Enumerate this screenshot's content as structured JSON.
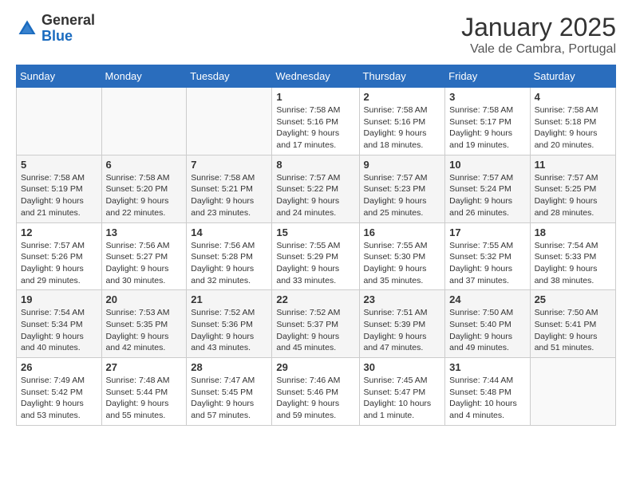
{
  "header": {
    "logo_general": "General",
    "logo_blue": "Blue",
    "month": "January 2025",
    "location": "Vale de Cambra, Portugal"
  },
  "days_of_week": [
    "Sunday",
    "Monday",
    "Tuesday",
    "Wednesday",
    "Thursday",
    "Friday",
    "Saturday"
  ],
  "weeks": [
    [
      {
        "day": "",
        "info": ""
      },
      {
        "day": "",
        "info": ""
      },
      {
        "day": "",
        "info": ""
      },
      {
        "day": "1",
        "info": "Sunrise: 7:58 AM\nSunset: 5:16 PM\nDaylight: 9 hours\nand 17 minutes."
      },
      {
        "day": "2",
        "info": "Sunrise: 7:58 AM\nSunset: 5:16 PM\nDaylight: 9 hours\nand 18 minutes."
      },
      {
        "day": "3",
        "info": "Sunrise: 7:58 AM\nSunset: 5:17 PM\nDaylight: 9 hours\nand 19 minutes."
      },
      {
        "day": "4",
        "info": "Sunrise: 7:58 AM\nSunset: 5:18 PM\nDaylight: 9 hours\nand 20 minutes."
      }
    ],
    [
      {
        "day": "5",
        "info": "Sunrise: 7:58 AM\nSunset: 5:19 PM\nDaylight: 9 hours\nand 21 minutes."
      },
      {
        "day": "6",
        "info": "Sunrise: 7:58 AM\nSunset: 5:20 PM\nDaylight: 9 hours\nand 22 minutes."
      },
      {
        "day": "7",
        "info": "Sunrise: 7:58 AM\nSunset: 5:21 PM\nDaylight: 9 hours\nand 23 minutes."
      },
      {
        "day": "8",
        "info": "Sunrise: 7:57 AM\nSunset: 5:22 PM\nDaylight: 9 hours\nand 24 minutes."
      },
      {
        "day": "9",
        "info": "Sunrise: 7:57 AM\nSunset: 5:23 PM\nDaylight: 9 hours\nand 25 minutes."
      },
      {
        "day": "10",
        "info": "Sunrise: 7:57 AM\nSunset: 5:24 PM\nDaylight: 9 hours\nand 26 minutes."
      },
      {
        "day": "11",
        "info": "Sunrise: 7:57 AM\nSunset: 5:25 PM\nDaylight: 9 hours\nand 28 minutes."
      }
    ],
    [
      {
        "day": "12",
        "info": "Sunrise: 7:57 AM\nSunset: 5:26 PM\nDaylight: 9 hours\nand 29 minutes."
      },
      {
        "day": "13",
        "info": "Sunrise: 7:56 AM\nSunset: 5:27 PM\nDaylight: 9 hours\nand 30 minutes."
      },
      {
        "day": "14",
        "info": "Sunrise: 7:56 AM\nSunset: 5:28 PM\nDaylight: 9 hours\nand 32 minutes."
      },
      {
        "day": "15",
        "info": "Sunrise: 7:55 AM\nSunset: 5:29 PM\nDaylight: 9 hours\nand 33 minutes."
      },
      {
        "day": "16",
        "info": "Sunrise: 7:55 AM\nSunset: 5:30 PM\nDaylight: 9 hours\nand 35 minutes."
      },
      {
        "day": "17",
        "info": "Sunrise: 7:55 AM\nSunset: 5:32 PM\nDaylight: 9 hours\nand 37 minutes."
      },
      {
        "day": "18",
        "info": "Sunrise: 7:54 AM\nSunset: 5:33 PM\nDaylight: 9 hours\nand 38 minutes."
      }
    ],
    [
      {
        "day": "19",
        "info": "Sunrise: 7:54 AM\nSunset: 5:34 PM\nDaylight: 9 hours\nand 40 minutes."
      },
      {
        "day": "20",
        "info": "Sunrise: 7:53 AM\nSunset: 5:35 PM\nDaylight: 9 hours\nand 42 minutes."
      },
      {
        "day": "21",
        "info": "Sunrise: 7:52 AM\nSunset: 5:36 PM\nDaylight: 9 hours\nand 43 minutes."
      },
      {
        "day": "22",
        "info": "Sunrise: 7:52 AM\nSunset: 5:37 PM\nDaylight: 9 hours\nand 45 minutes."
      },
      {
        "day": "23",
        "info": "Sunrise: 7:51 AM\nSunset: 5:39 PM\nDaylight: 9 hours\nand 47 minutes."
      },
      {
        "day": "24",
        "info": "Sunrise: 7:50 AM\nSunset: 5:40 PM\nDaylight: 9 hours\nand 49 minutes."
      },
      {
        "day": "25",
        "info": "Sunrise: 7:50 AM\nSunset: 5:41 PM\nDaylight: 9 hours\nand 51 minutes."
      }
    ],
    [
      {
        "day": "26",
        "info": "Sunrise: 7:49 AM\nSunset: 5:42 PM\nDaylight: 9 hours\nand 53 minutes."
      },
      {
        "day": "27",
        "info": "Sunrise: 7:48 AM\nSunset: 5:44 PM\nDaylight: 9 hours\nand 55 minutes."
      },
      {
        "day": "28",
        "info": "Sunrise: 7:47 AM\nSunset: 5:45 PM\nDaylight: 9 hours\nand 57 minutes."
      },
      {
        "day": "29",
        "info": "Sunrise: 7:46 AM\nSunset: 5:46 PM\nDaylight: 9 hours\nand 59 minutes."
      },
      {
        "day": "30",
        "info": "Sunrise: 7:45 AM\nSunset: 5:47 PM\nDaylight: 10 hours\nand 1 minute."
      },
      {
        "day": "31",
        "info": "Sunrise: 7:44 AM\nSunset: 5:48 PM\nDaylight: 10 hours\nand 4 minutes."
      },
      {
        "day": "",
        "info": ""
      }
    ]
  ]
}
